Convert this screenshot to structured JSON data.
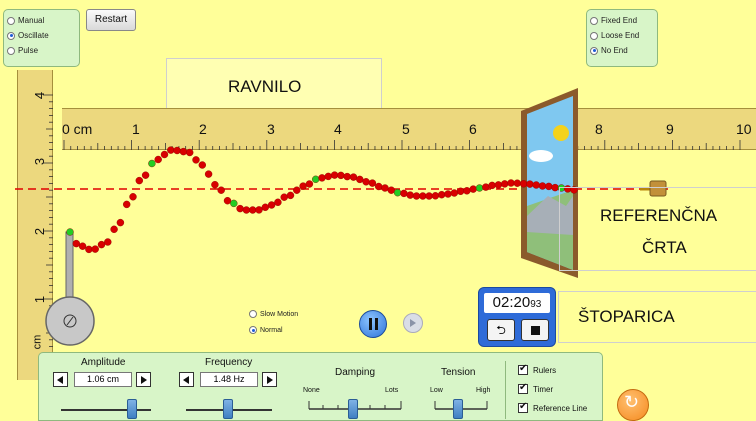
{
  "mode_panel": {
    "options": [
      {
        "label": "Manual",
        "selected": false
      },
      {
        "label": "Oscillate",
        "selected": true
      },
      {
        "label": "Pulse",
        "selected": false
      }
    ]
  },
  "restart_button": {
    "label": "Restart"
  },
  "end_panel": {
    "options": [
      {
        "label": "Fixed End",
        "selected": false
      },
      {
        "label": "Loose End",
        "selected": false
      },
      {
        "label": "No End",
        "selected": true
      }
    ]
  },
  "annotations": {
    "ruler": "RAVNILO",
    "reference_line_1": "REFERENČNA",
    "reference_line_2": "ČRTA",
    "stopwatch": "ŠTOPARICA"
  },
  "horizontal_ruler": {
    "labels": [
      "0 cm",
      "1",
      "2",
      "3",
      "4",
      "5",
      "6",
      "7",
      "8",
      "9",
      "10"
    ]
  },
  "vertical_ruler": {
    "labels": [
      "4",
      "3",
      "2",
      "1"
    ],
    "unit": "cm"
  },
  "speed_panel": {
    "options": [
      {
        "label": "Slow Motion",
        "selected": false
      },
      {
        "label": "Normal",
        "selected": true
      }
    ]
  },
  "timer": {
    "main": "02:20",
    "fraction": "93"
  },
  "controls": {
    "amplitude": {
      "title": "Amplitude",
      "value": "1.06 cm"
    },
    "frequency": {
      "title": "Frequency",
      "value": "1.48 Hz"
    },
    "damping": {
      "title": "Damping",
      "low": "None",
      "high": "Lots"
    },
    "tension": {
      "title": "Tension",
      "low": "Low",
      "high": "High"
    }
  },
  "checkboxes": [
    {
      "label": "Rulers",
      "checked": true
    },
    {
      "label": "Timer",
      "checked": true
    },
    {
      "label": "Reference Line",
      "checked": true
    }
  ],
  "colors": {
    "background": "#FFFF99",
    "ruler": "#ECD87E",
    "panel": "#D8F5C8",
    "bead": "#D80000",
    "bead_highlight": "#22CC22",
    "reference_line": "#E00000",
    "timer_blue": "#2E6BD8",
    "reset_orange": "#F58A1F"
  }
}
